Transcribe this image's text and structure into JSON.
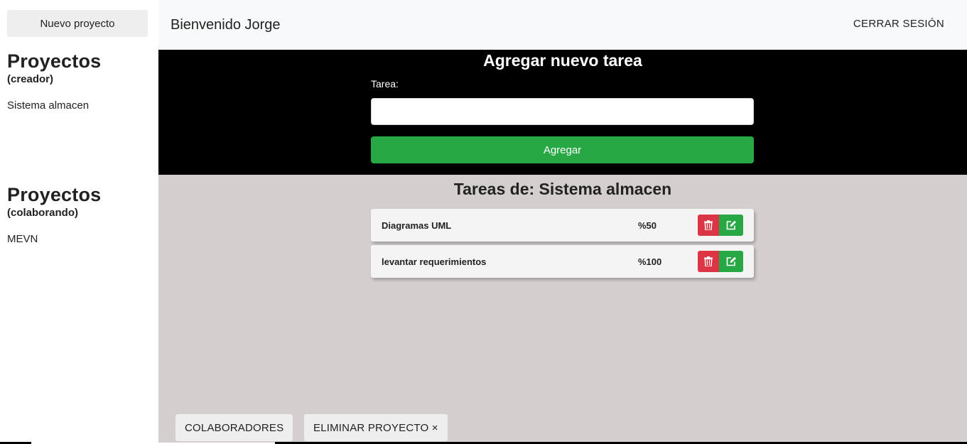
{
  "sidebar": {
    "new_project_label": "Nuevo proyecto",
    "creator_section": {
      "title": "Proyectos",
      "subtitle": "(creador)",
      "projects": [
        "Sistema almacen"
      ]
    },
    "collab_section": {
      "title": "Proyectos",
      "subtitle": "(colaborando)",
      "projects": [
        "MEVN"
      ]
    }
  },
  "header": {
    "welcome": "Bienvenido Jorge",
    "logout_label": "CERRAR SESIÓN"
  },
  "form": {
    "title": "Agregar nuevo tarea",
    "task_label": "Tarea:",
    "task_value": "",
    "submit_label": "Agregar"
  },
  "tasks": {
    "title": "Tareas de: Sistema almacen",
    "items": [
      {
        "name": "Diagramas UML",
        "progress": "%50"
      },
      {
        "name": "levantar requerimientos",
        "progress": "%100"
      }
    ]
  },
  "footer": {
    "collaborators_label": "COLABORADORES",
    "delete_project_label": "ELIMINAR PROYECTO ×"
  },
  "icons": {
    "delete": "trash-icon",
    "edit": "edit-icon"
  },
  "colors": {
    "danger": "#dc3545",
    "success": "#28a745",
    "form_bg": "#000000",
    "tasks_bg": "#d5cece"
  }
}
